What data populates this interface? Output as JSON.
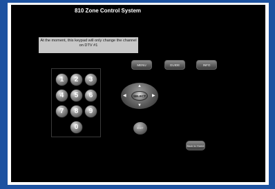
{
  "app": {
    "title": "810 Zone Control System"
  },
  "notice": {
    "text": "At the moment, this keypad will only change the channel on DTV #1"
  },
  "keypad": {
    "keys": [
      "1",
      "2",
      "3",
      "4",
      "5",
      "6",
      "7",
      "8",
      "9",
      "0"
    ]
  },
  "top_buttons": {
    "menu": "MENU",
    "guide": "GUIDE",
    "info": "INFO"
  },
  "navigation": {
    "select": "SELECT",
    "up_icon": "arrow-up",
    "down_icon": "arrow-down",
    "left_icon": "arrow-left",
    "right_icon": "arrow-right"
  },
  "misc": {
    "exit": "EXIT",
    "back_to_home": "Back to Home"
  },
  "colors": {
    "frame_blue": "#1d52a0",
    "screen_black": "#000000",
    "notice_gray": "#c8c8c8"
  }
}
